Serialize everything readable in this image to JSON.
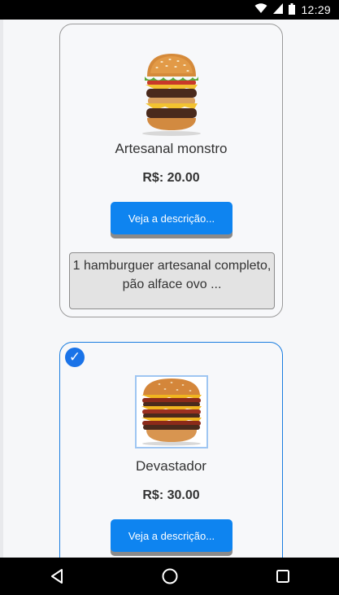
{
  "status_bar": {
    "time": "12:29",
    "icons": [
      "wifi-icon",
      "signal-icon",
      "battery-icon"
    ]
  },
  "products": [
    {
      "name": "Artesanal monstro",
      "price": "R$: 20.00",
      "button_label": "Veja a descrição...",
      "description": "1 hamburguer artesanal completo, pão alface ovo ...",
      "selected": false,
      "image": "burger-image"
    },
    {
      "name": "Devastador",
      "price": "R$: 30.00",
      "button_label": "Veja a descrição...",
      "selected": true,
      "selected_badge": "✓",
      "image": "burger-image"
    }
  ],
  "nav_bar": {
    "icons": [
      "back-icon",
      "home-icon",
      "recents-icon"
    ]
  },
  "colors": {
    "accent": "#0e84f0",
    "selected_border": "#1a7de0"
  }
}
